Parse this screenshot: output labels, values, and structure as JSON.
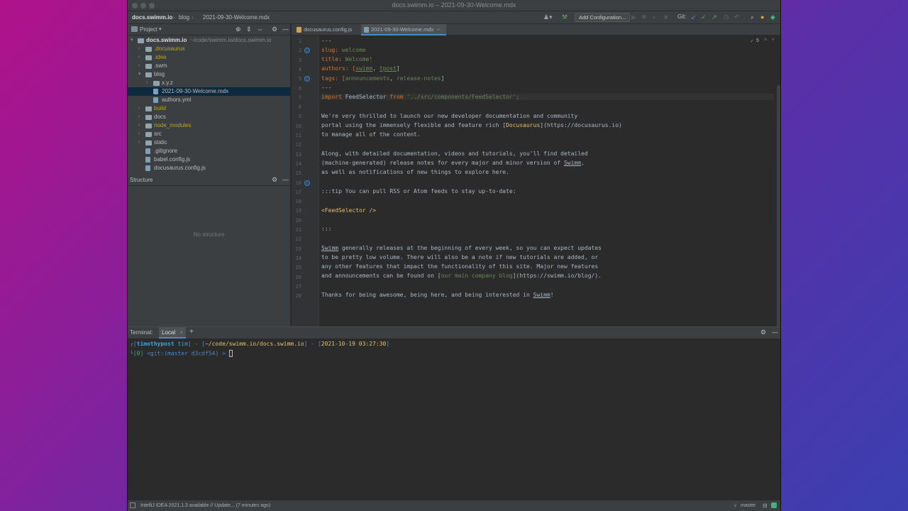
{
  "window_title": "docs.swimm.io – 2021-09-30-Welcome.mdx",
  "breadcrumb": [
    "docs.swimm.io",
    "blog",
    "2021-09-30-Welcome.mdx"
  ],
  "toolbar": {
    "add_config_label": "Add Configuration...",
    "git_label": "Git:"
  },
  "project_panel": {
    "title": "Project",
    "root_label": "docs.swimm.io",
    "root_path": "~/code/swimm.io/docs.swimm.io",
    "items": [
      {
        "label": ".docusaurus",
        "color": "#b6a32d"
      },
      {
        "label": ".idea",
        "color": "#b6a32d"
      },
      {
        "label": ".swm",
        "color": "#bbbbbb"
      },
      {
        "label": "blog",
        "color": "#bbbbbb"
      },
      {
        "label": "x.y.z",
        "color": "#bbbbbb"
      },
      {
        "label": "2021-09-30-Welcome.mdx",
        "color": "#bbbbbb"
      },
      {
        "label": "authors.yml",
        "color": "#bbbbbb"
      },
      {
        "label": "build",
        "color": "#b6a32d"
      },
      {
        "label": "docs",
        "color": "#bbbbbb"
      },
      {
        "label": "node_modules",
        "color": "#b6a32d"
      },
      {
        "label": "src",
        "color": "#bbbbbb"
      },
      {
        "label": "static",
        "color": "#bbbbbb"
      },
      {
        "label": ".gitignore",
        "color": "#bbbbbb"
      },
      {
        "label": "babel.config.js",
        "color": "#bbbbbb"
      },
      {
        "label": "docusaurus.config.js",
        "color": "#bbbbbb"
      }
    ]
  },
  "structure_panel": {
    "title": "Structure",
    "empty_text": "No structure"
  },
  "tabs": [
    {
      "label": "docusaurus.config.js"
    },
    {
      "label": "2021-09-30-Welcome.mdx"
    }
  ],
  "editor": {
    "inspection_count": "5",
    "line_numbers": [
      "1",
      "2",
      "3",
      "4",
      "5",
      "6",
      "7",
      "8",
      "9",
      "10",
      "11",
      "12",
      "13",
      "14",
      "15",
      "16",
      "17",
      "18",
      "19",
      "20",
      "21",
      "22",
      "23",
      "24",
      "25",
      "26",
      "27",
      "28"
    ],
    "lines": {
      "l1": "---",
      "l2a": "slug: ",
      "l2b": "welcome",
      "l3a": "title: ",
      "l3b": "Welcome!",
      "l4a": "authors: [",
      "l4b": "swimm",
      "l4c": ", ",
      "l4d": "tpost",
      "l4e": "]",
      "l5a": "tags: [",
      "l5b": "announcements",
      "l5c": ", ",
      "l5d": "release-notes",
      "l5e": "]",
      "l6": "---",
      "l7a": "import",
      "l7b": " FeedSelector ",
      "l7c": "from",
      "l7d": " ",
      "l7e": "'../src/components/FeedSelector'",
      "l7f": ";",
      "l9": "We're very thrilled to launch our new developer documentation and community",
      "l10a": "portal using the immensely flexible and feature rich [",
      "l10b": "Docusaurus",
      "l10c": "](https://docusaurus.io)",
      "l11": "to manage all of the content.",
      "l13": "Along, with detailed documentation, videos and tutorials, you'll find detailed",
      "l14a": "(machine-generated) release notes for every major and minor version of ",
      "l14b": "Swimm",
      "l14c": ",",
      "l15": "as well as notifications of new things to explore here.",
      "l17": ":::tip You can pull RSS or Atom feeds to stay up-to-date:",
      "l19": "<FeedSelector />",
      "l21": ":::",
      "l23a": "Swimm",
      "l23b": " generally releases at the beginning of every week, so you can expect updates",
      "l24": "to be pretty low volume. There will also be a note if new tutorials are added, or",
      "l25": "any other features that impact the functionality of this site. Major new features",
      "l26a": "and announcements can be found on [",
      "l26b": "our main company blog",
      "l26c": "](https://swimm.io/blog/).",
      "l28a": "Thanks for being awesome, being here, and being interested in ",
      "l28b": "Swimm",
      "l28c": "!"
    }
  },
  "terminal": {
    "label": "Terminal:",
    "tab_label": "Local",
    "add_label": "+",
    "line1a": "┌[",
    "line1b": "timothypost",
    "line1c": " tim",
    "line1d": "] - [",
    "line1e": "~/code/swimm.io/docs.swimm.io",
    "line1f": "] - [",
    "line1g": "2021-10-19 03:27:30",
    "line1h": "]",
    "line2a": "└[",
    "line2b": "0",
    "line2c": "] ",
    "line2d": "<git:(master d3cdf54) >",
    "line2e": " "
  },
  "statusbar": {
    "message": "IntelliJ IDEA 2021.1.3 available // Update... (7 minutes ago)",
    "branch": "master"
  },
  "colors": {
    "accent": "#4a88c7",
    "selection": "#0d293e",
    "bg": "#2b2b2b"
  }
}
